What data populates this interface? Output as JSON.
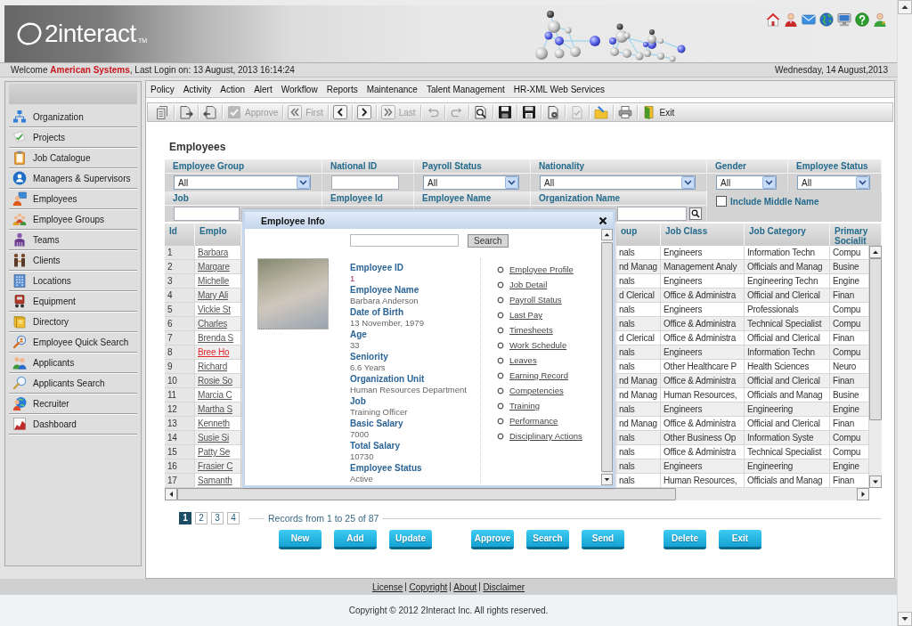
{
  "header": {
    "logo": "2interact",
    "trademark": "TM"
  },
  "welcome_bar": {
    "greeting": "Welcome **American Systems**, Last Login on: 13 August, 2013 16:14:24",
    "date": "Wednesday, 14 August,2013"
  },
  "sidebar": {
    "items": [
      "Organization",
      "Projects",
      "Job Catalogue",
      "Managers & Supervisors",
      "Employees",
      "Employee Groups",
      "Teams",
      "Clients",
      "Locations",
      "Equipment",
      "Directory",
      "Employee Quick Search",
      "Applicants",
      "Applicants Search",
      "Recruiter",
      "Dashboard"
    ]
  },
  "menu": [
    "Policy",
    "Activity",
    "Action",
    "Alert",
    "Workflow",
    "Reports",
    "Maintenance",
    "Talent Management",
    "HR-XML Web Services"
  ],
  "toolbar": [
    {
      "kind": "icon",
      "disabled": false
    },
    {
      "kind": "icon",
      "disabled": false
    },
    {
      "kind": "icon",
      "disabled": false
    },
    {
      "kind": "labeled",
      "label": "Approve",
      "disabled": true
    },
    {
      "kind": "labeled",
      "label": "First",
      "disabled": true
    },
    {
      "kind": "icon",
      "disabled": false
    },
    {
      "kind": "icon",
      "disabled": false
    },
    {
      "kind": "labeled",
      "label": "Last",
      "disabled": true
    },
    {
      "kind": "icon",
      "disabled": true
    },
    {
      "kind": "icon",
      "disabled": true
    },
    {
      "kind": "icon",
      "disabled": false
    },
    {
      "kind": "icon",
      "disabled": false
    },
    {
      "kind": "icon",
      "disabled": false
    },
    {
      "kind": "icon",
      "disabled": false
    },
    {
      "kind": "icon",
      "disabled": true
    },
    {
      "kind": "icon",
      "disabled": false
    },
    {
      "kind": "icon",
      "disabled": false
    },
    {
      "kind": "labeled",
      "label": "Exit",
      "disabled": false
    }
  ],
  "page_title": "Employees",
  "filters": [
    {
      "label": "Employee Group",
      "kind": "select",
      "value": "All"
    },
    {
      "label": "National ID",
      "kind": "text"
    },
    {
      "label": "Payroll Status",
      "kind": "select",
      "value": "All"
    },
    {
      "label": "Nationality",
      "kind": "select",
      "value": "All"
    },
    {
      "label": "Gender",
      "kind": "select",
      "value": "All"
    },
    {
      "label": "Employee Status",
      "kind": "select",
      "value": "All"
    },
    {
      "label": "Job",
      "kind": "text"
    },
    {
      "label": "Employee Id",
      "kind": "label"
    },
    {
      "label": "Employee Name",
      "kind": "label"
    },
    {
      "label": "Organization Name",
      "kind": "search"
    },
    {
      "label": "Include Middle Name",
      "kind": "checkbox",
      "checked": false
    }
  ],
  "table": {
    "columns": [
      "Id",
      "Emplo",
      "oup",
      "Job Class",
      "Job Category",
      "Primary Socialit"
    ],
    "rows": [
      {
        "id": "1",
        "name": "Barbara",
        "flagged": false,
        "column_3": "nals",
        "job_class": "Engineers",
        "job_category": "Information Techn",
        "column_6": "Compu"
      },
      {
        "id": "2",
        "name": "Margare",
        "flagged": false,
        "column_3": "nd Manag",
        "job_class": "Management Analy",
        "job_category": "Officials and Manag",
        "column_6": "Busine"
      },
      {
        "id": "3",
        "name": "Michelle",
        "flagged": false,
        "column_3": "nals",
        "job_class": "Engineers",
        "job_category": "Engineering Techn",
        "column_6": "Engine"
      },
      {
        "id": "4",
        "name": "Mary Ali",
        "flagged": false,
        "column_3": "d Clerical",
        "job_class": "Office & Administra",
        "job_category": "Official and Clerical",
        "column_6": "Finan"
      },
      {
        "id": "5",
        "name": "Vickie St",
        "flagged": false,
        "column_3": "nals",
        "job_class": "Engineers",
        "job_category": "Professionals",
        "column_6": "Compu"
      },
      {
        "id": "6",
        "name": "Charles",
        "flagged": false,
        "column_3": "nals",
        "job_class": "Office & Administra",
        "job_category": "Technical Specialist",
        "column_6": "Compu"
      },
      {
        "id": "7",
        "name": "Brenda S",
        "flagged": false,
        "column_3": "d Clerical",
        "job_class": "Office & Administra",
        "job_category": "Official and Clerical",
        "column_6": "Finan"
      },
      {
        "id": "8",
        "name": "Bree Ho",
        "flagged": true,
        "column_3": "nals",
        "job_class": "Engineers",
        "job_category": "Information Techn",
        "column_6": "Compu"
      },
      {
        "id": "9",
        "name": "Richard",
        "flagged": false,
        "column_3": "nals",
        "job_class": "Other Healthcare P",
        "job_category": "Health Sciences",
        "column_6": "Neuro"
      },
      {
        "id": "10",
        "name": "Rosie So",
        "flagged": false,
        "column_3": "nd Manag",
        "job_class": "Office & Administra",
        "job_category": "Official and Clerical",
        "column_6": "Finan"
      },
      {
        "id": "11",
        "name": "Marcia C",
        "flagged": false,
        "column_3": "nd Manag",
        "job_class": "Human Resources,",
        "job_category": "Officials and Manag",
        "column_6": "Busine"
      },
      {
        "id": "12",
        "name": "Martha S",
        "flagged": false,
        "column_3": "nals",
        "job_class": "Engineers",
        "job_category": "Engineering",
        "column_6": "Engine"
      },
      {
        "id": "13",
        "name": "Kenneth",
        "flagged": false,
        "column_3": "nd Manag",
        "job_class": "Office & Administra",
        "job_category": "Official and Clerical",
        "column_6": "Finan"
      },
      {
        "id": "14",
        "name": "Susie Si",
        "flagged": false,
        "column_3": "nals",
        "job_class": "Other Business Op",
        "job_category": "Information Syste",
        "column_6": "Compu"
      },
      {
        "id": "15",
        "name": "Patty Se",
        "flagged": false,
        "column_3": "nals",
        "job_class": "Office & Administra",
        "job_category": "Technical Specialist",
        "column_6": "Compu"
      },
      {
        "id": "16",
        "name": "Frasier C",
        "flagged": false,
        "column_3": "nals",
        "job_class": "Engineers",
        "job_category": "Engineering",
        "column_6": "Engine"
      },
      {
        "id": "17",
        "name": "Samanth",
        "flagged": false,
        "column_3": "nals",
        "job_class": "Human Resources,",
        "job_category": "Officials and Manag",
        "column_6": "Finan"
      }
    ]
  },
  "pagination": {
    "pages": [
      {
        "label": "1",
        "selected": true
      },
      {
        "label": "2",
        "selected": false
      },
      {
        "label": "3",
        "selected": false
      },
      {
        "label": "4",
        "selected": false
      }
    ],
    "records": "Records from 1 to 25 of 87"
  },
  "button_groups": [
    [
      "New",
      "Add",
      "Update"
    ],
    [
      "Approve",
      "Search",
      "Send"
    ],
    [
      "Delete",
      "Exit"
    ]
  ],
  "dialog": {
    "title": "Employee Info",
    "search_button": "Search",
    "fields": [
      {
        "label": "Employee ID",
        "value": "1"
      },
      {
        "label": "Employee Name",
        "value": "Barbara Anderson"
      },
      {
        "label": "Date of Birth",
        "value": "13 November, 1979"
      },
      {
        "label": "Age",
        "value": "33"
      },
      {
        "label": "Seniority",
        "value": "6.6 Years"
      },
      {
        "label": "Organization Unit",
        "value": "Human Resources Department"
      },
      {
        "label": "Job",
        "value": "Training Officer"
      },
      {
        "label": "Basic Salary",
        "value": "7000"
      },
      {
        "label": "Total Salary",
        "value": "10730"
      },
      {
        "label": "Employee Status",
        "value": "Active"
      }
    ],
    "links": [
      "Employee Profile",
      "Job Detail",
      "Payroll Status",
      "Last Pay",
      "Timesheets",
      "Work Schedule",
      "Leaves",
      "Earning Record",
      "Competencies",
      "Training",
      "Performance",
      "Disciplinary Actions"
    ]
  },
  "footer": {
    "links": [
      "License",
      "Copyright",
      "About",
      "Disclaimer"
    ],
    "copyright": "Copyright © 2012 2Interact Inc. All rights reserved."
  }
}
